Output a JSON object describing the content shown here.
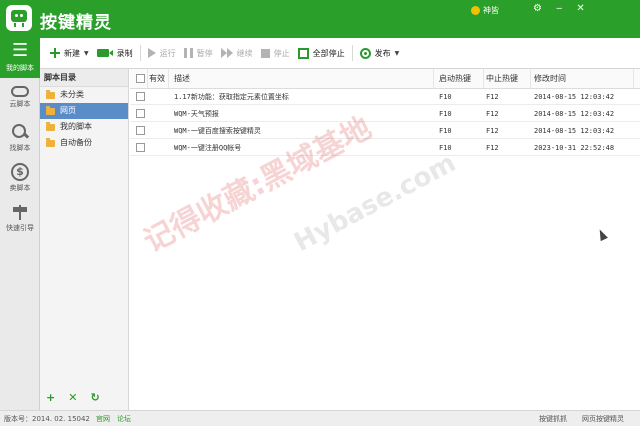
{
  "app": {
    "title": "按键精灵"
  },
  "user": {
    "name": "神皆"
  },
  "window_icons": [
    "gear-icon",
    "minimize-icon",
    "close-icon"
  ],
  "toolbar": {
    "new_label": "新建",
    "record_label": "录制",
    "run_label": "运行",
    "pause_label": "暂停",
    "continue_label": "继续",
    "stop_label": "停止",
    "stop_all_label": "全部停止",
    "publish_label": "发布"
  },
  "nav": {
    "items": [
      {
        "label": "我的脚本",
        "icon": "list-icon",
        "active": true
      },
      {
        "label": "云脚本",
        "icon": "cloud-icon",
        "active": false
      },
      {
        "label": "找脚本",
        "icon": "search-icon",
        "active": false
      },
      {
        "label": "卖脚本",
        "icon": "dollar-icon",
        "active": false
      },
      {
        "label": "快速引导",
        "icon": "signpost-icon",
        "active": false
      }
    ]
  },
  "directory": {
    "header": "脚本目录",
    "items": [
      {
        "label": "未分类",
        "selected": false
      },
      {
        "label": "网页",
        "selected": true
      },
      {
        "label": "我的脚本",
        "selected": false
      },
      {
        "label": "自动备份",
        "selected": false
      }
    ]
  },
  "table": {
    "headers": {
      "enabled": "有效",
      "description": "描述",
      "start_hotkey": "启动热键",
      "stop_hotkey": "中止热键",
      "modified": "修改时间"
    },
    "rows": [
      {
        "description": "1.17新功能：获取指定元素位置坐标",
        "start_hotkey": "F10",
        "stop_hotkey": "F12",
        "modified": "2014-08-15 12:03:42"
      },
      {
        "description": "WQM-天气预报",
        "start_hotkey": "F10",
        "stop_hotkey": "F12",
        "modified": "2014-08-15 12:03:42"
      },
      {
        "description": "WQM-一键百度搜索按键精灵",
        "start_hotkey": "F10",
        "stop_hotkey": "F12",
        "modified": "2014-08-15 12:03:42"
      },
      {
        "description": "WQM-一键注册QQ帐号",
        "start_hotkey": "F10",
        "stop_hotkey": "F12",
        "modified": "2023-10-31 22:52:48"
      }
    ]
  },
  "watermark": {
    "text": "记得收藏:黑域基地",
    "text2": "Hybase.com"
  },
  "statusbar": {
    "version": "版本号：2014. 02. 15042",
    "link_official": "官网",
    "link_forum": "论坛",
    "right_1": "按键抓抓",
    "right_2": "网页按键精灵"
  },
  "colors": {
    "brand_green": "#2aa02a",
    "selection_blue": "#5a8dc7"
  }
}
